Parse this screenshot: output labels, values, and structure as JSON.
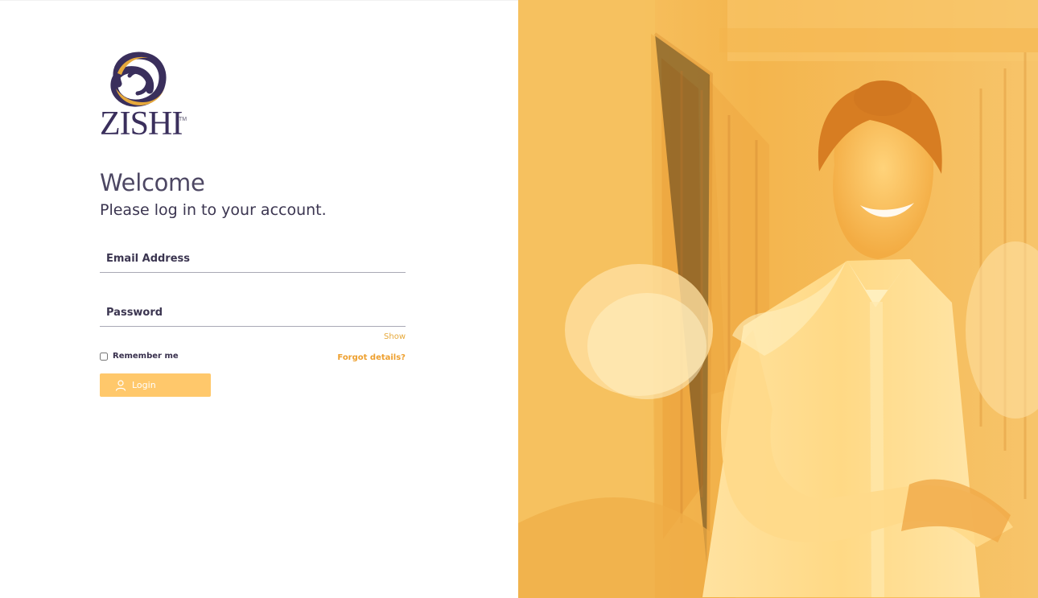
{
  "brand": {
    "name": "ZISHI",
    "trademark": "TM"
  },
  "heading": {
    "welcome": "Welcome",
    "subtitle": "Please log in to your account."
  },
  "form": {
    "email_placeholder": "Email Address",
    "password_placeholder": "Password",
    "show_label": "Show",
    "remember_label": "Remember me",
    "forgot_label": "Forgot details?",
    "login_label": "Login"
  },
  "colors": {
    "brand_purple": "#3a2f5c",
    "brand_gold": "#e7a93b",
    "login_button": "#ffc86b",
    "photo_overlay": "#f4b84f"
  },
  "icons": {
    "user": "user-icon"
  }
}
